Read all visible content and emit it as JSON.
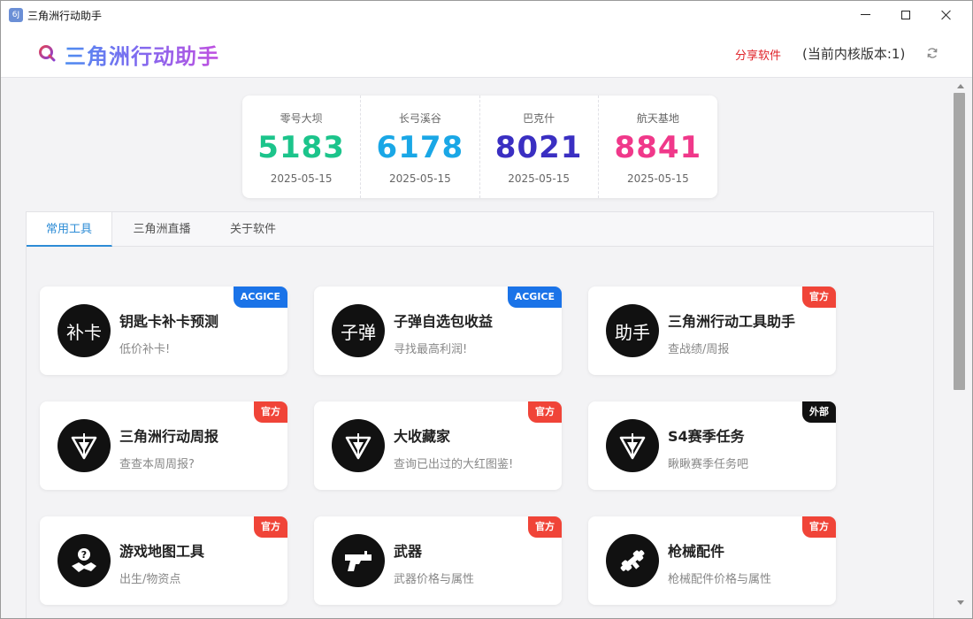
{
  "window": {
    "title": "三角洲行动助手",
    "app_icon_glyph": "6J"
  },
  "header": {
    "brand_title": "三角洲行动助手",
    "share_label": "分享软件",
    "version_text": "(当前内核版本:1)"
  },
  "stats": [
    {
      "name": "零号大坝",
      "code": "5183",
      "date": "2025-05-15",
      "color": "#1cc48b"
    },
    {
      "name": "长弓溪谷",
      "code": "6178",
      "date": "2025-05-15",
      "color": "#1aa7e6"
    },
    {
      "name": "巴克什",
      "code": "8021",
      "date": "2025-05-15",
      "color": "#3a2fc2"
    },
    {
      "name": "航天基地",
      "code": "8841",
      "date": "2025-05-15",
      "color": "#f0388a"
    }
  ],
  "tabs": [
    {
      "label": "常用工具",
      "active": true
    },
    {
      "label": "三角洲直播",
      "active": false
    },
    {
      "label": "关于软件",
      "active": false
    }
  ],
  "badge_colors": {
    "ACGICE": "#1a73e8",
    "官方": "#f04438",
    "外部": "#111111"
  },
  "tools": [
    {
      "title": "钥匙卡补卡预测",
      "desc": "低价补卡!",
      "badge": "ACGICE",
      "icon_text": "补卡",
      "icon": "text-icon"
    },
    {
      "title": "子弹自选包收益",
      "desc": "寻找最高利润!",
      "badge": "ACGICE",
      "icon_text": "子弹",
      "icon": "text-icon"
    },
    {
      "title": "三角洲行动工具助手",
      "desc": "查战绩/周报",
      "badge": "官方",
      "icon_text": "助手",
      "icon": "text-icon"
    },
    {
      "title": "三角洲行动周报",
      "desc": "查查本周周报?",
      "badge": "官方",
      "icon_text": "",
      "icon": "delta-emblem-icon"
    },
    {
      "title": "大收藏家",
      "desc": "查询已出过的大红图鉴!",
      "badge": "官方",
      "icon_text": "",
      "icon": "delta-emblem-icon"
    },
    {
      "title": "S4赛季任务",
      "desc": "瞅瞅赛季任务吧",
      "badge": "外部",
      "icon_text": "",
      "icon": "delta-emblem-icon"
    },
    {
      "title": "游戏地图工具",
      "desc": "出生/物资点",
      "badge": "官方",
      "icon_text": "",
      "icon": "map-icon"
    },
    {
      "title": "武器",
      "desc": "武器价格与属性",
      "badge": "官方",
      "icon_text": "",
      "icon": "pistol-icon"
    },
    {
      "title": "枪械配件",
      "desc": "枪械配件价格与属性",
      "badge": "官方",
      "icon_text": "",
      "icon": "scope-icon"
    }
  ]
}
